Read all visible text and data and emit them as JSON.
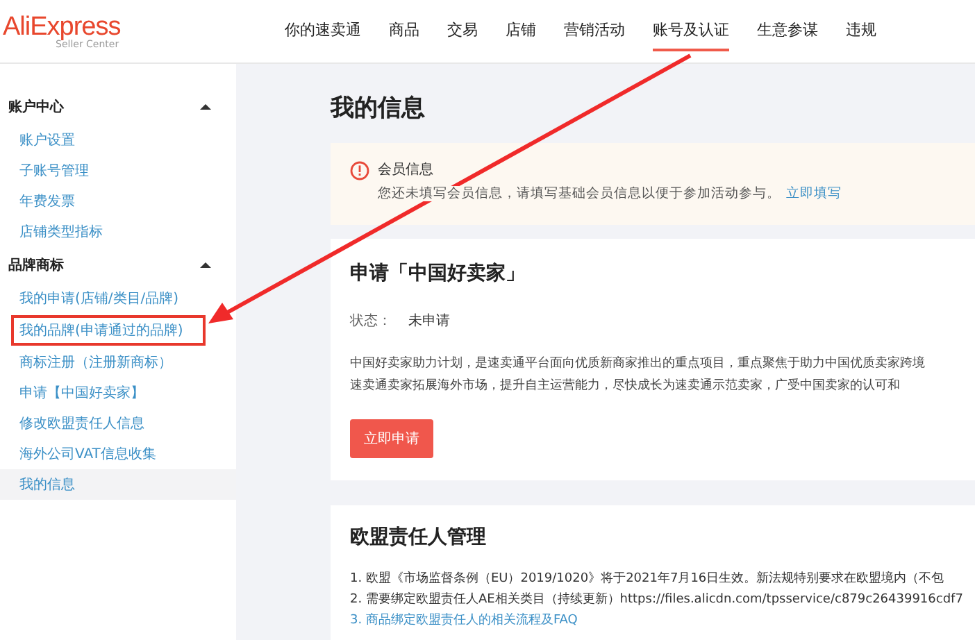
{
  "logo": {
    "name": "AliExpress",
    "subtitle": "Seller Center"
  },
  "nav": [
    {
      "label": "你的速卖通",
      "selected": false
    },
    {
      "label": "商品",
      "selected": false
    },
    {
      "label": "交易",
      "selected": false
    },
    {
      "label": "店铺",
      "selected": false
    },
    {
      "label": "营销活动",
      "selected": false
    },
    {
      "label": "账号及认证",
      "selected": true
    },
    {
      "label": "生意参谋",
      "selected": false
    },
    {
      "label": "违规",
      "selected": false
    }
  ],
  "sidebar": [
    {
      "title": "账户中心",
      "expanded": true,
      "items": [
        {
          "label": "账户设置",
          "selected": false,
          "highlighted": false
        },
        {
          "label": "子账号管理",
          "selected": false,
          "highlighted": false
        },
        {
          "label": "年费发票",
          "selected": false,
          "highlighted": false
        },
        {
          "label": "店铺类型指标",
          "selected": false,
          "highlighted": false
        }
      ]
    },
    {
      "title": "品牌商标",
      "expanded": true,
      "items": [
        {
          "label": "我的申请(店铺/类目/品牌)",
          "selected": false,
          "highlighted": false
        },
        {
          "label": "我的品牌(申请通过的品牌)",
          "selected": false,
          "highlighted": true
        },
        {
          "label": "商标注册（注册新商标）",
          "selected": false,
          "highlighted": false
        },
        {
          "label": "申请【中国好卖家】",
          "selected": false,
          "highlighted": false
        },
        {
          "label": "修改欧盟责任人信息",
          "selected": false,
          "highlighted": false
        },
        {
          "label": "海外公司VAT信息收集",
          "selected": false,
          "highlighted": false
        },
        {
          "label": "我的信息",
          "selected": true,
          "highlighted": false
        }
      ]
    }
  ],
  "page_title": "我的信息",
  "alert": {
    "title": "会员信息",
    "message": "您还未填写会员信息，请填写基础会员信息以便于参加活动参与。",
    "link": "立即填写"
  },
  "apply_card": {
    "title": "申请「中国好卖家」",
    "status_label": "状态：",
    "status_value": "未申请",
    "description": [
      "中国好卖家助力计划，是速卖通平台面向优质新商家推出的重点项目，重点聚焦于助力中国优质卖家跨境",
      "速卖通卖家拓展海外市场，提升自主运营能力，尽快成长为速卖通示范卖家，广受中国卖家的认可和"
    ],
    "button": "立即申请"
  },
  "eu_card": {
    "title": "欧盟责任人管理",
    "lines": [
      {
        "kind": "text",
        "text": "1. 欧盟《市场监督条例（EU）2019/1020》将于2021年7月16日生效。新法规特别要求在欧盟境内（不包"
      },
      {
        "kind": "text",
        "text": "2. 需要绑定欧盟责任人AE相关类目（持续更新）https://files.alicdn.com/tpsservice/c879c26439916cdf7"
      },
      {
        "kind": "link",
        "text": "3. 商品绑定欧盟责任人的相关流程及FAQ"
      }
    ]
  }
}
